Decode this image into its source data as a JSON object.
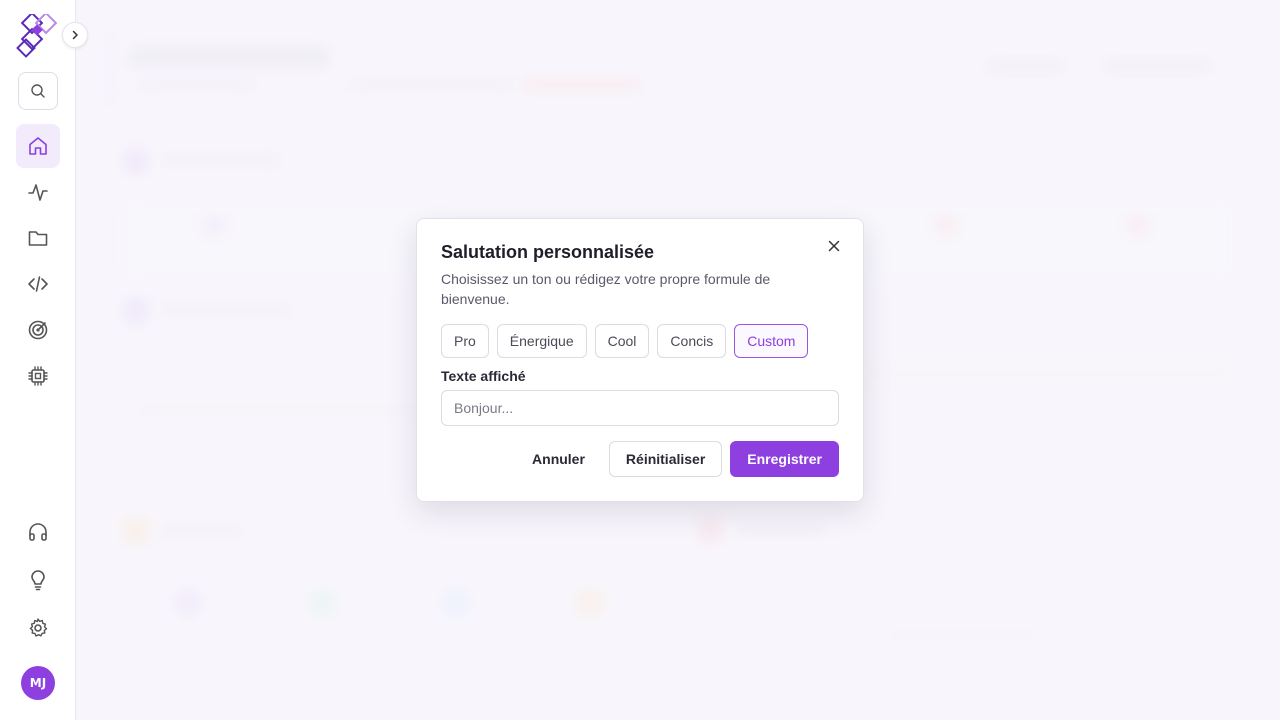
{
  "sidebar": {
    "logo_icon": "brand-logo-icon",
    "expand_icon": "chevron-right-icon",
    "search_icon": "search-icon",
    "items": [
      {
        "name": "home",
        "icon": "home-icon",
        "active": true
      },
      {
        "name": "activity",
        "icon": "activity-icon",
        "active": false
      },
      {
        "name": "files",
        "icon": "folder-icon",
        "active": false
      },
      {
        "name": "code",
        "icon": "code-icon",
        "active": false
      },
      {
        "name": "goals",
        "icon": "target-icon",
        "active": false
      },
      {
        "name": "hardware",
        "icon": "chip-icon",
        "active": false
      }
    ],
    "bottom_items": [
      {
        "name": "support",
        "icon": "headphones-icon"
      },
      {
        "name": "ideas",
        "icon": "lightbulb-icon"
      },
      {
        "name": "settings",
        "icon": "gear-icon"
      }
    ],
    "avatar_initials": "MJ"
  },
  "modal": {
    "title": "Salutation personnalisée",
    "description": "Choisissez un ton ou rédigez votre propre formule de bienvenue.",
    "tones": [
      "Pro",
      "Énergique",
      "Cool",
      "Concis",
      "Custom"
    ],
    "selected_tone": "Custom",
    "field_label": "Texte affiché",
    "field_value": "",
    "field_placeholder": "Bonjour...",
    "cancel_label": "Annuler",
    "reset_label": "Réinitialiser",
    "save_label": "Enregistrer",
    "close_icon": "close-icon"
  },
  "colors": {
    "accent": "#8d3fe0",
    "accent_light": "#f1ebfb"
  }
}
